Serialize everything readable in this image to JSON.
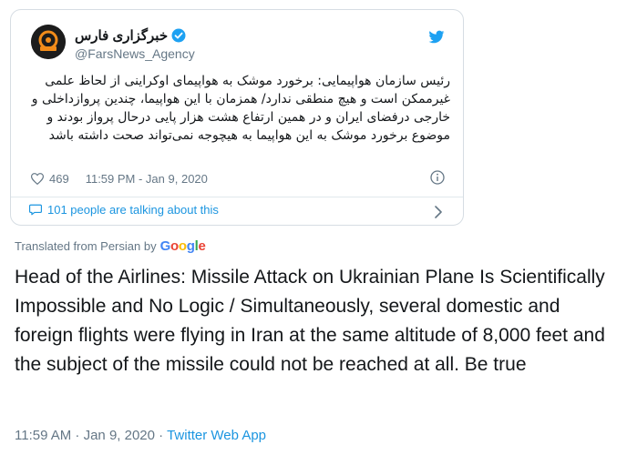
{
  "tweet": {
    "account_name": "خبرگزاری فارس",
    "handle": "@FarsNews_Agency",
    "text": "رئیس سازمان هواپیمایی: برخورد موشک به هواپیمای اوکراینی از لحاظ علمی غیرممکن است و هیچ منطقی ندارد/ همزمان با این هواپیما، چندین پروازداخلی و خارجی درفضای ایران و در همین ارتفاع هشت هزار پایی درحال پرواز بودند و موضوع برخورد موشک به این هواپیما به هیچوجه نمی‌تواند صحت داشته باشد",
    "likes": "469",
    "timestamp": "11:59 PM - Jan 9, 2020",
    "talking": "101 people are talking about this"
  },
  "translation": {
    "label": "Translated from Persian by",
    "provider": "Google",
    "provider_letters": [
      {
        "ch": "G",
        "color": "#4285F4"
      },
      {
        "ch": "o",
        "color": "#EA4335"
      },
      {
        "ch": "o",
        "color": "#FBBC05"
      },
      {
        "ch": "g",
        "color": "#4285F4"
      },
      {
        "ch": "l",
        "color": "#34A853"
      },
      {
        "ch": "e",
        "color": "#EA4335"
      }
    ],
    "text": "Head of the Airlines: Missile Attack on Ukrainian Plane Is Scientifically Impossible and No Logic / Simultaneously, several domestic and foreign flights were flying in Iran at the same altitude of 8,000 feet and the subject of the missile could not be reached at all. Be true"
  },
  "footer": {
    "time": "11:59 AM · Jan 9, 2020 · ",
    "app": "Twitter Web App"
  },
  "colors": {
    "accent": "#1b95e0",
    "muted": "#657786",
    "verified": "#1da1f2"
  },
  "icons": [
    "verified-badge-icon",
    "twitter-bird-icon",
    "heart-icon",
    "info-icon",
    "speech-bubble-icon",
    "chevron-right-icon"
  ]
}
